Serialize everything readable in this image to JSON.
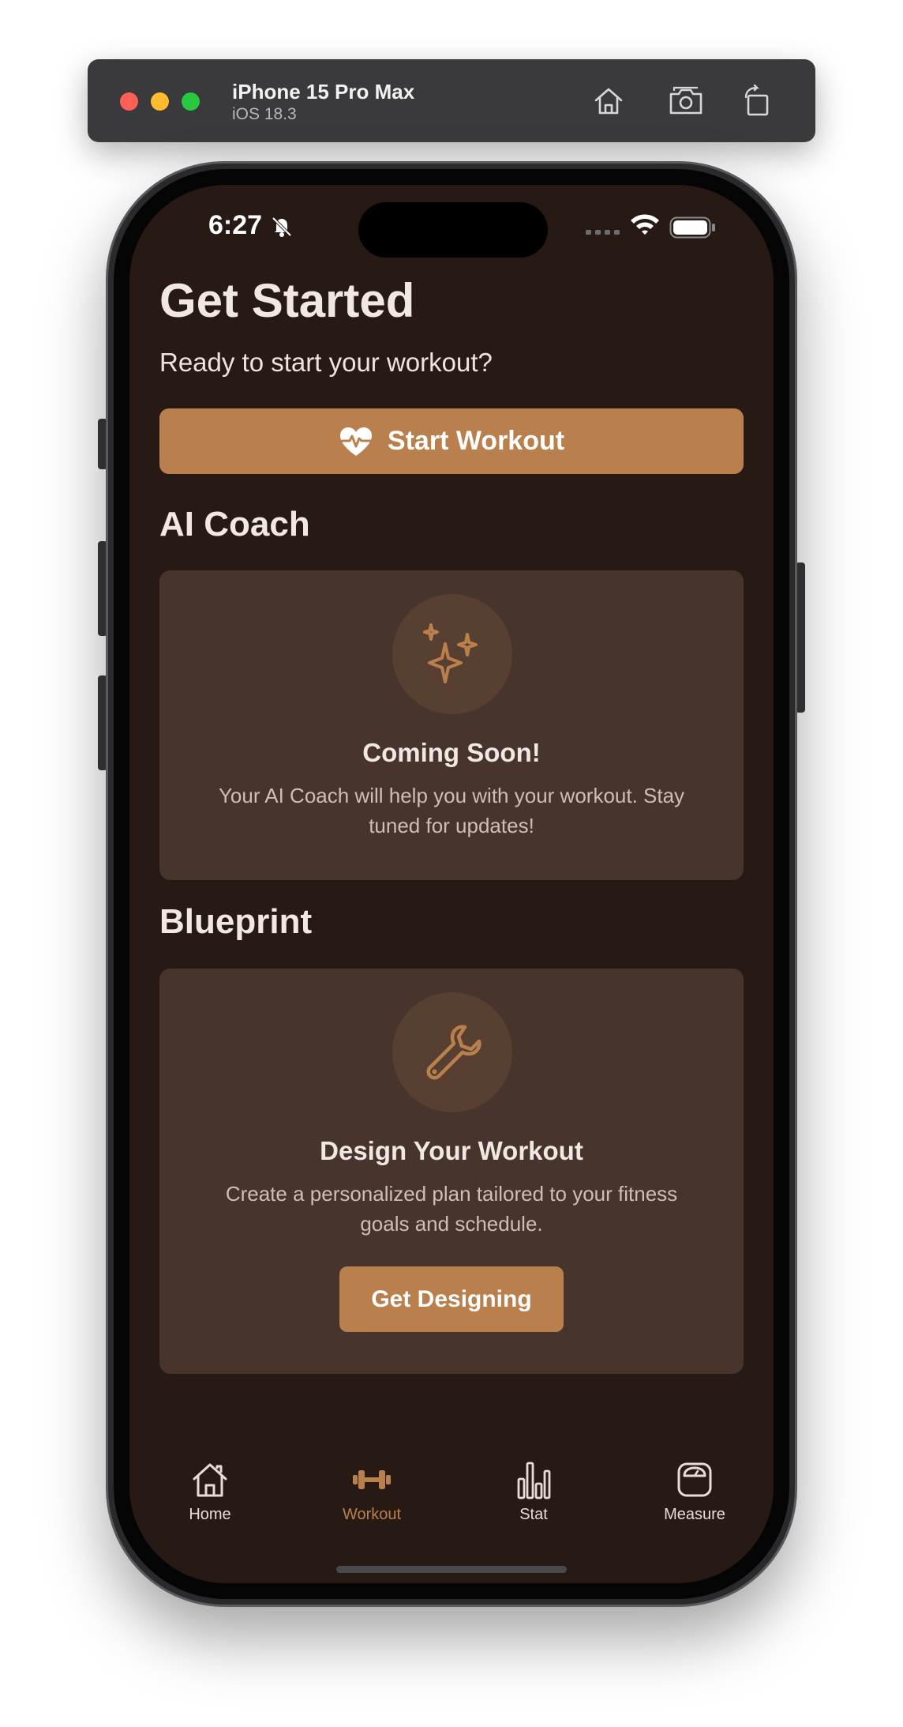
{
  "simulator": {
    "device_name": "iPhone 15 Pro Max",
    "os_version": "iOS 18.3",
    "buttons": {
      "home_icon": "house-icon",
      "screenshot_icon": "camera-icon",
      "rotate_icon": "rotate-icon"
    }
  },
  "status_bar": {
    "time": "6:27",
    "silent_icon": "bell-slash-icon",
    "signal_icon": "signal-icon",
    "wifi_icon": "wifi-icon",
    "battery_icon": "battery-icon"
  },
  "header": {
    "title": "Get Started",
    "subtitle": "Ready to start your workout?"
  },
  "start_workout": {
    "label": "Start Workout",
    "icon": "heart-pulse-icon"
  },
  "ai_coach": {
    "heading": "AI Coach",
    "icon": "sparkles-icon",
    "title": "Coming Soon!",
    "description": "Your AI Coach will help you with your workout. Stay tuned for updates!"
  },
  "blueprint": {
    "heading": "Blueprint",
    "icon": "wrench-icon",
    "title": "Design Your Workout",
    "description": "Create a personalized plan tailored to your fitness goals and schedule.",
    "button_label": "Get Designing"
  },
  "tab_bar": {
    "active": "Workout",
    "tabs": [
      {
        "label": "Home",
        "icon": "house-icon"
      },
      {
        "label": "Workout",
        "icon": "dumbbell-icon"
      },
      {
        "label": "Stat",
        "icon": "bar-chart-icon"
      },
      {
        "label": "Measure",
        "icon": "scale-icon"
      }
    ]
  },
  "colors": {
    "background": "#271a14",
    "card": "#47352d",
    "accent": "#b9804d",
    "text_primary": "#f1e8e1",
    "text_secondary": "#cdbfb4",
    "tab_inactive": "#e8ddd5"
  }
}
